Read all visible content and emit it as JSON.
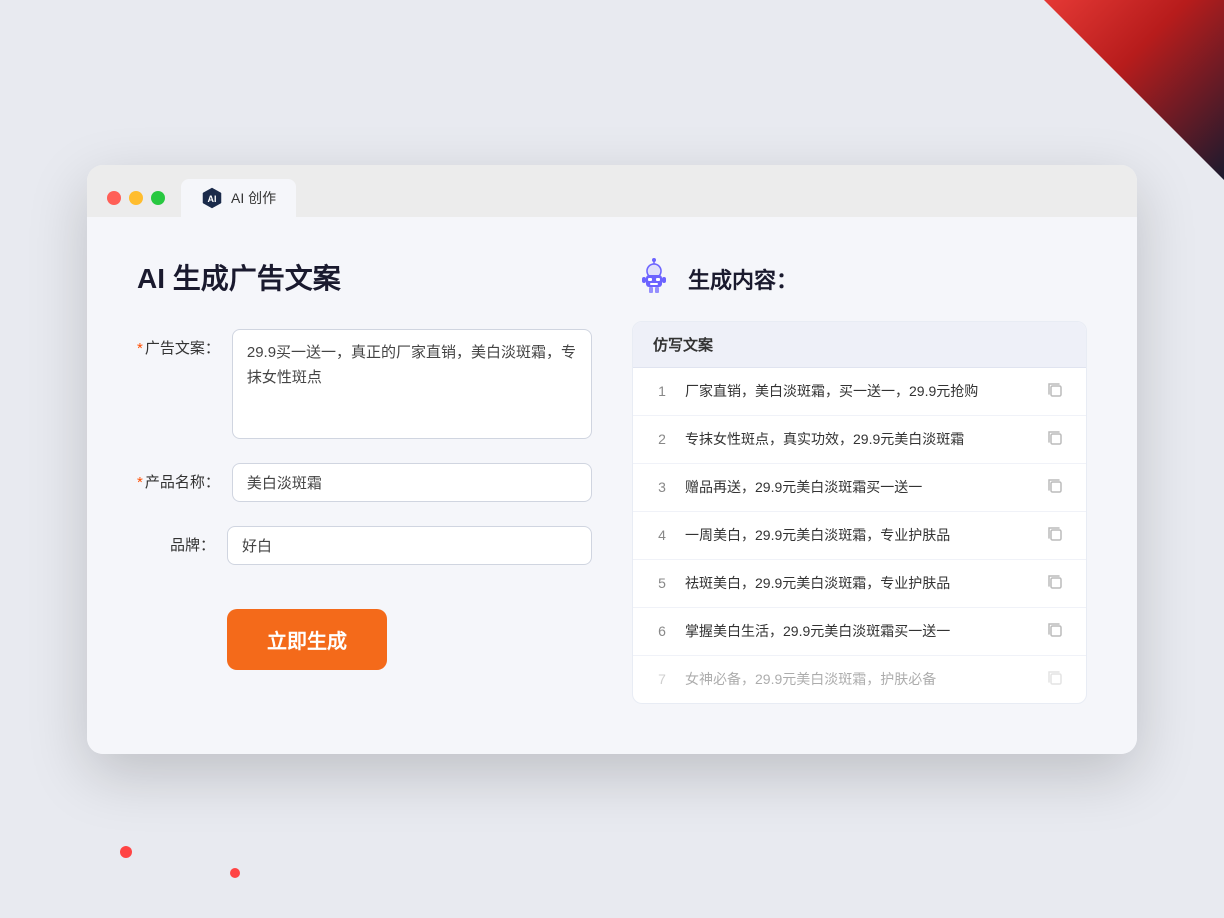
{
  "decorative": {
    "corner_top_right": true,
    "dot1": true,
    "dot2": true
  },
  "browser": {
    "tab_label": "AI 创作",
    "traffic_lights": [
      "red",
      "yellow",
      "green"
    ]
  },
  "left_panel": {
    "title": "AI 生成广告文案",
    "fields": [
      {
        "id": "ad_copy",
        "label": "广告文案：",
        "required": true,
        "type": "textarea",
        "value": "29.9买一送一，真正的厂家直销，美白淡斑霜，专抹女性斑点"
      },
      {
        "id": "product_name",
        "label": "产品名称：",
        "required": true,
        "type": "input",
        "value": "美白淡斑霜"
      },
      {
        "id": "brand",
        "label": "品牌：",
        "required": false,
        "type": "input",
        "value": "好白"
      }
    ],
    "generate_button": "立即生成"
  },
  "right_panel": {
    "title": "生成内容：",
    "column_header": "仿写文案",
    "results": [
      {
        "num": "1",
        "text": "厂家直销，美白淡斑霜，买一送一，29.9元抢购",
        "dimmed": false
      },
      {
        "num": "2",
        "text": "专抹女性斑点，真实功效，29.9元美白淡斑霜",
        "dimmed": false
      },
      {
        "num": "3",
        "text": "赠品再送，29.9元美白淡斑霜买一送一",
        "dimmed": false
      },
      {
        "num": "4",
        "text": "一周美白，29.9元美白淡斑霜，专业护肤品",
        "dimmed": false
      },
      {
        "num": "5",
        "text": "祛斑美白，29.9元美白淡斑霜，专业护肤品",
        "dimmed": false
      },
      {
        "num": "6",
        "text": "掌握美白生活，29.9元美白淡斑霜买一送一",
        "dimmed": false
      },
      {
        "num": "7",
        "text": "女神必备，29.9元美白淡斑霜，护肤必备",
        "dimmed": true
      }
    ]
  }
}
